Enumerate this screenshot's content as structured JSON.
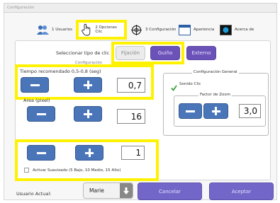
{
  "window": {
    "title": "Configuración"
  },
  "tabs": [
    {
      "label": "1 Usuarios",
      "icon": "users-icon"
    },
    {
      "label": "2 Opciones Clic",
      "icon": "hand-pointer-icon"
    },
    {
      "label": "3 Configuración",
      "icon": "crosshair-icon"
    },
    {
      "label": "Apariencia",
      "icon": "window-icon"
    },
    {
      "label": "Acerca de",
      "icon": "monitor-icon"
    }
  ],
  "click_type": {
    "label": "Seleccionar tipo de clic",
    "options": [
      {
        "label": "Fijación",
        "selected": false
      },
      {
        "label": "Guiño",
        "selected": true
      },
      {
        "label": "Externo",
        "selected": true
      }
    ],
    "section_caption": "Configuración"
  },
  "time": {
    "label": "Tiempo recomendado 0,5-0,8 (seg)",
    "value": "0,7"
  },
  "area": {
    "label": "Area (pixel)",
    "value": "16"
  },
  "smoothing": {
    "value": "1",
    "checkbox_label": "Activar Suavizado (5 Bajo, 10 Medio, 15 Alto)",
    "checked": false
  },
  "general": {
    "title": "Configuración General",
    "sound_label": "Sonido Clic",
    "sound_checked": true,
    "zoom_title": "Factor de Zoom",
    "zoom_value": "3,0"
  },
  "footer": {
    "user_label": "Usuario Actual:",
    "user_value": "Marie",
    "cancel_label": "Cancelar",
    "accept_label": "Aceptar"
  },
  "colors": {
    "accent": "#4a76b9",
    "button": "#7266c8",
    "highlight": "#fff200"
  }
}
